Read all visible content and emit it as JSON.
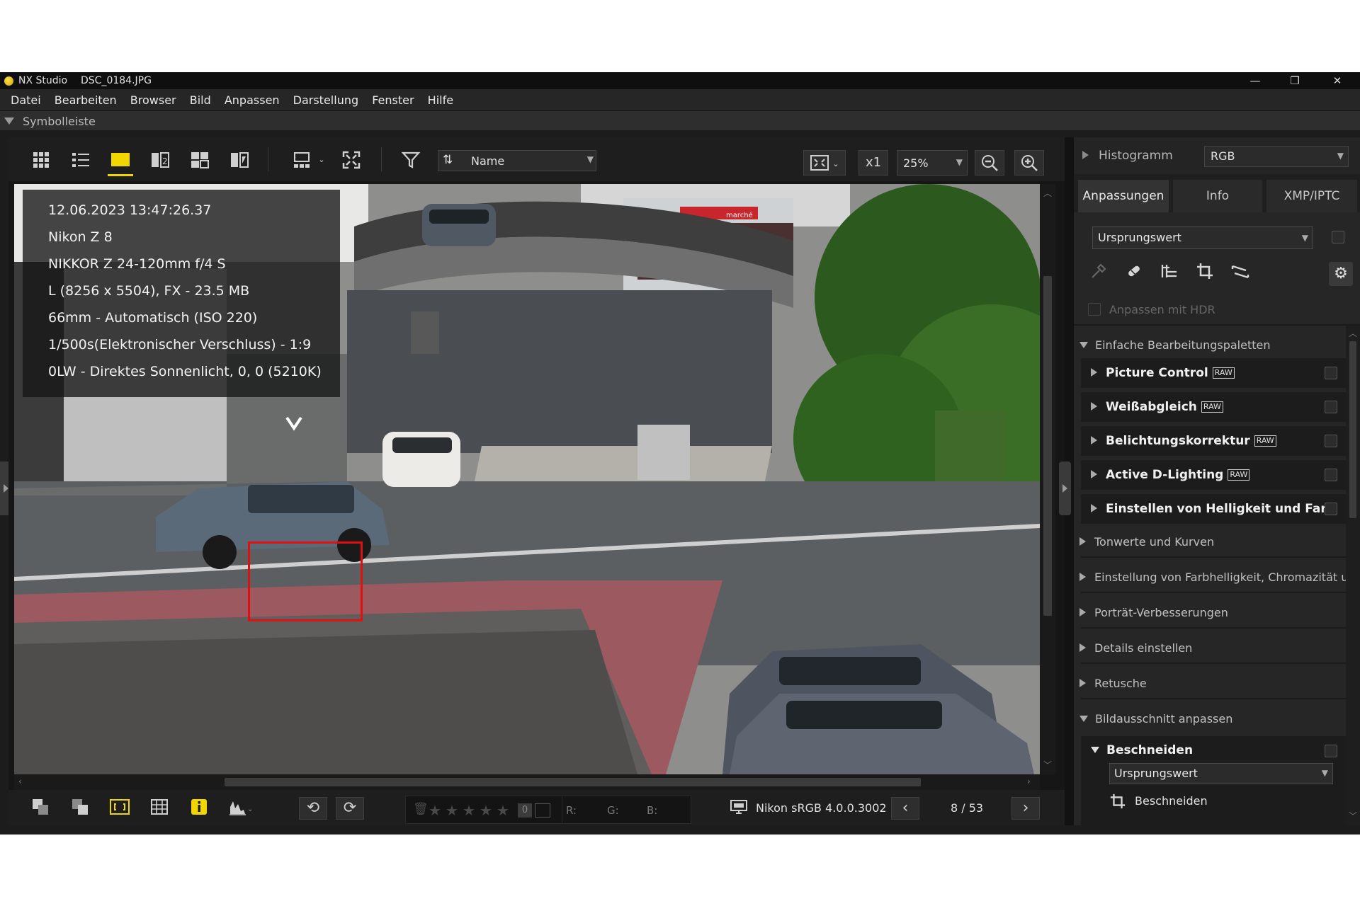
{
  "window": {
    "app_name": "NX Studio",
    "file_name": "DSC_0184.JPG",
    "minimize": "—",
    "restore": "❐",
    "close": "✕"
  },
  "menu": [
    "Datei",
    "Bearbeiten",
    "Browser",
    "Bild",
    "Anpassen",
    "Darstellung",
    "Fenster",
    "Hilfe"
  ],
  "symbolbar": {
    "label": "Symbolleiste"
  },
  "toolbar": {
    "sort_label": "Name",
    "scale_label": "x1",
    "zoom_value": "25%"
  },
  "photo_info": [
    "12.06.2023 13:47:26.37",
    "Nikon Z 8",
    "NIKKOR Z 24-120mm f/4 S",
    "L (8256 x 5504), FX - 23.5 MB",
    "66mm - Automatisch (ISO 220)",
    "1/500s(Elektronischer Verschluss) - 1:9",
    "0LW - Direktes Sonnenlicht, 0, 0 (5210K)"
  ],
  "photo_sign": "marché",
  "bottom": {
    "rating_count": "0",
    "r_label": "R:",
    "g_label": "G:",
    "b_label": "B:",
    "color_profile": "Nikon sRGB 4.0.0.3002",
    "page_count": "8 / 53"
  },
  "right": {
    "histogram_label": "Histogramm",
    "histogram_mode": "RGB",
    "tabs": [
      "Anpassungen",
      "Info",
      "XMP/IPTC"
    ],
    "preset": "Ursprungswert",
    "hdr_label": "Anpassen mit HDR",
    "section_basic": "Einfache Bearbeitungspaletten",
    "palettes": [
      {
        "label": "Picture Control",
        "raw": "RAW"
      },
      {
        "label": "Weißabgleich",
        "raw": "RAW"
      },
      {
        "label": "Belichtungskorrektur",
        "raw": "RAW"
      },
      {
        "label": "Active D-Lighting",
        "raw": "RAW"
      },
      {
        "label": "Einstellen von Helligkeit und Farb",
        "raw": ""
      }
    ],
    "sections": [
      "Tonwerte und Kurven",
      "Einstellung von Farbhelligkeit, Chromazität u",
      "Porträt-Verbesserungen",
      "Details einstellen",
      "Retusche"
    ],
    "section_crop": "Bildausschnitt anpassen",
    "crop_title": "Beschneiden",
    "crop_preset": "Ursprungswert",
    "crop_tool": "Beschneiden"
  }
}
